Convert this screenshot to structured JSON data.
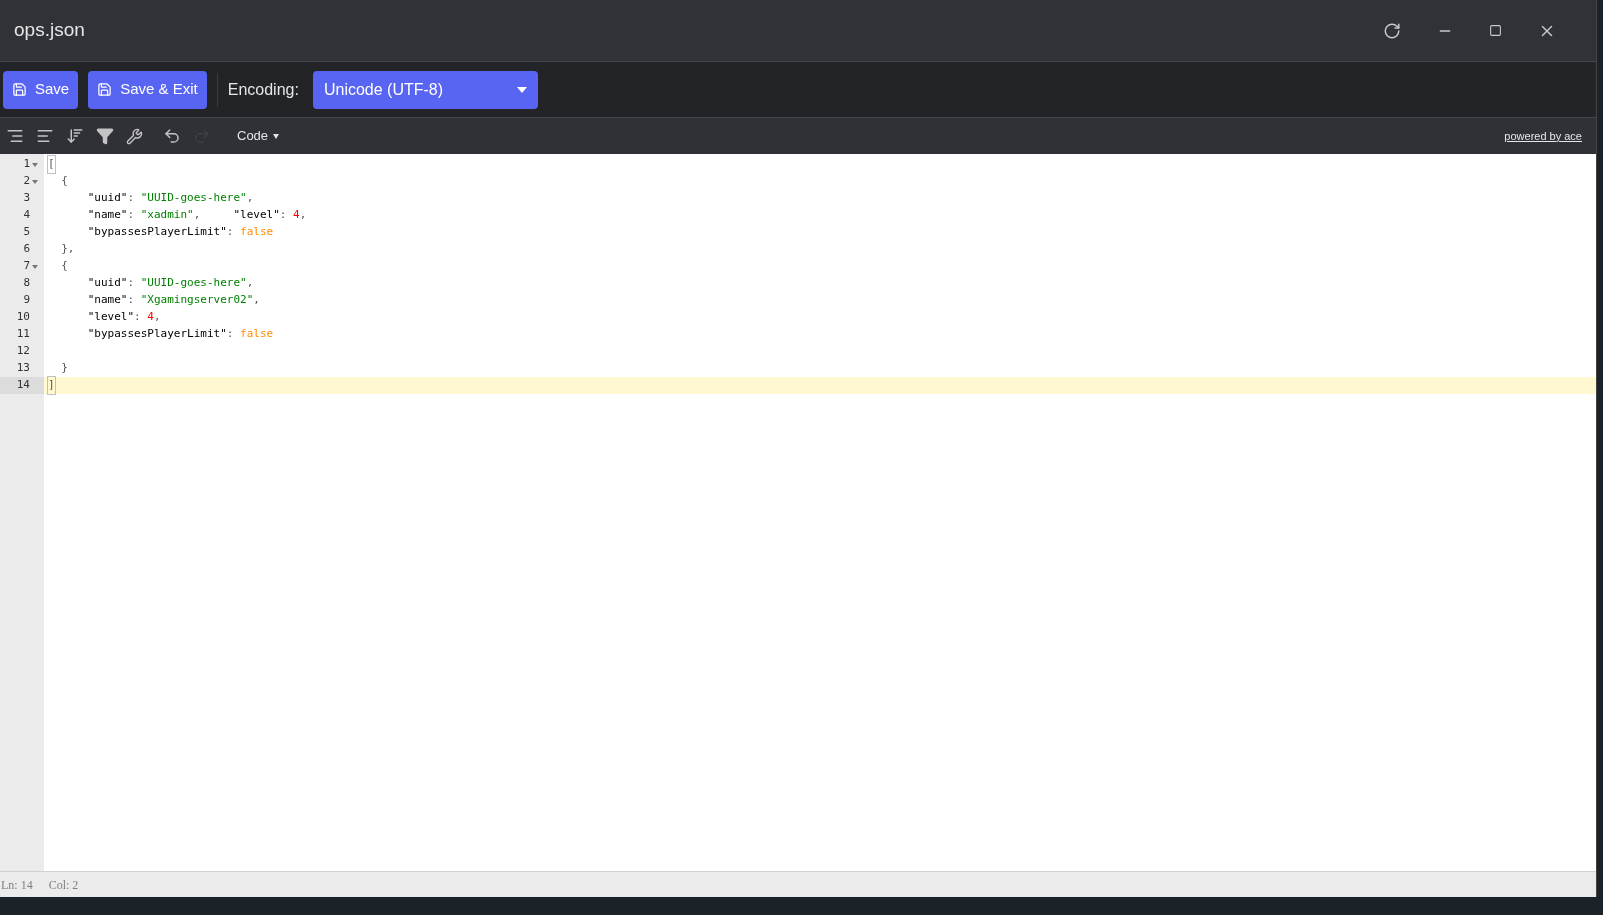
{
  "window": {
    "title": "ops.json"
  },
  "toolbar": {
    "save": "Save",
    "save_exit": "Save & Exit",
    "encoding_label": "Encoding:",
    "encoding_value": "Unicode (UTF-8)"
  },
  "editor_toolbar": {
    "mode": "Code",
    "credit": "powered by ace"
  },
  "lines": [
    {
      "number": "1",
      "foldable": true,
      "active": false,
      "tokens": [
        {
          "kind": "bracket",
          "text": "["
        }
      ]
    },
    {
      "number": "2",
      "foldable": true,
      "active": false,
      "tokens": [
        {
          "kind": "punct",
          "text": "  {"
        }
      ]
    },
    {
      "number": "3",
      "foldable": false,
      "active": false,
      "tokens": [
        {
          "kind": "key",
          "text": "      \"uuid\""
        },
        {
          "kind": "punct",
          "text": ": "
        },
        {
          "kind": "string",
          "text": "\"UUID-goes-here\""
        },
        {
          "kind": "punct",
          "text": ","
        }
      ]
    },
    {
      "number": "4",
      "foldable": false,
      "active": false,
      "tokens": [
        {
          "kind": "key",
          "text": "      \"name\""
        },
        {
          "kind": "punct",
          "text": ": "
        },
        {
          "kind": "string",
          "text": "\"xadmin\""
        },
        {
          "kind": "punct",
          "text": ",     "
        },
        {
          "kind": "key",
          "text": "\"level\""
        },
        {
          "kind": "punct",
          "text": ": "
        },
        {
          "kind": "number",
          "text": "4"
        },
        {
          "kind": "punct",
          "text": ","
        }
      ]
    },
    {
      "number": "5",
      "foldable": false,
      "active": false,
      "tokens": [
        {
          "kind": "key",
          "text": "      \"bypassesPlayerLimit\""
        },
        {
          "kind": "punct",
          "text": ": "
        },
        {
          "kind": "boolean",
          "text": "false"
        }
      ]
    },
    {
      "number": "6",
      "foldable": false,
      "active": false,
      "tokens": [
        {
          "kind": "punct",
          "text": "  },"
        }
      ]
    },
    {
      "number": "7",
      "foldable": true,
      "active": false,
      "tokens": [
        {
          "kind": "punct",
          "text": "  {"
        }
      ]
    },
    {
      "number": "8",
      "foldable": false,
      "active": false,
      "tokens": [
        {
          "kind": "key",
          "text": "      \"uuid\""
        },
        {
          "kind": "punct",
          "text": ": "
        },
        {
          "kind": "string",
          "text": "\"UUID-goes-here\""
        },
        {
          "kind": "punct",
          "text": ","
        }
      ]
    },
    {
      "number": "9",
      "foldable": false,
      "active": false,
      "tokens": [
        {
          "kind": "key",
          "text": "      \"name\""
        },
        {
          "kind": "punct",
          "text": ": "
        },
        {
          "kind": "string",
          "text": "\"Xgamingserver02\""
        },
        {
          "kind": "punct",
          "text": ","
        }
      ]
    },
    {
      "number": "10",
      "foldable": false,
      "active": false,
      "tokens": [
        {
          "kind": "key",
          "text": "      \"level\""
        },
        {
          "kind": "punct",
          "text": ": "
        },
        {
          "kind": "number",
          "text": "4"
        },
        {
          "kind": "punct",
          "text": ","
        }
      ]
    },
    {
      "number": "11",
      "foldable": false,
      "active": false,
      "tokens": [
        {
          "kind": "key",
          "text": "      \"bypassesPlayerLimit\""
        },
        {
          "kind": "punct",
          "text": ": "
        },
        {
          "kind": "boolean",
          "text": "false"
        }
      ]
    },
    {
      "number": "12",
      "foldable": false,
      "active": false
    },
    {
      "number": "13",
      "foldable": false,
      "active": false,
      "tokens": [
        {
          "kind": "punct",
          "text": "  }"
        }
      ]
    },
    {
      "number": "14",
      "foldable": false,
      "active": true,
      "tokens": [
        {
          "kind": "bracket",
          "text": "]"
        }
      ]
    }
  ],
  "status_bar": {
    "line": "Ln: 14",
    "column": "Col: 2"
  }
}
